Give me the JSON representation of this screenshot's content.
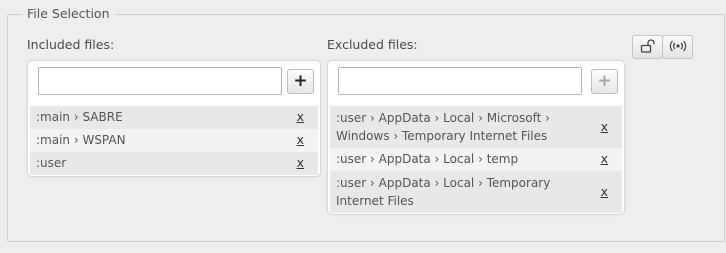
{
  "fieldset": {
    "legend": "File Selection"
  },
  "included": {
    "label": "Included files:",
    "input_value": "",
    "add_label": "+",
    "remove_label": "x",
    "items": [
      {
        "path": ":main › SABRE"
      },
      {
        "path": ":main › WSPAN"
      },
      {
        "path": ":user"
      }
    ]
  },
  "excluded": {
    "label": "Excluded files:",
    "input_value": "",
    "add_label": "+",
    "remove_label": "x",
    "items": [
      {
        "path": ":user › AppData › Local › Microsoft › Windows › Temporary Internet Files"
      },
      {
        "path": ":user › AppData › Local › temp"
      },
      {
        "path": ":user › AppData › Local › Temporary Internet Files"
      }
    ]
  },
  "toolbar": {
    "lock_icon": "unlock-icon",
    "broadcast_icon": "broadcast-icon"
  }
}
